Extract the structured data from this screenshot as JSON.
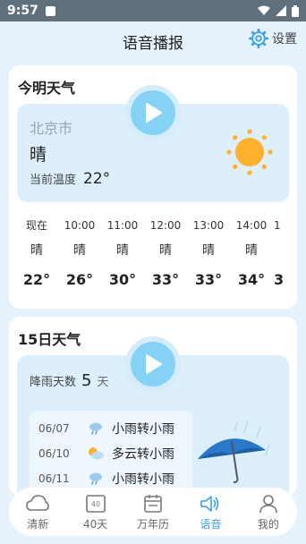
{
  "status_bar": {
    "time": "9:57"
  },
  "header": {
    "title": "语音播报",
    "settings_label": "设置"
  },
  "today": {
    "title": "今明天气",
    "city": "北京市",
    "condition": "晴",
    "current_temp_label": "当前温度",
    "current_temp": "22°",
    "hourly": [
      {
        "time": "现在",
        "cond": "晴",
        "temp": "22°"
      },
      {
        "time": "10:00",
        "cond": "晴",
        "temp": "26°"
      },
      {
        "time": "11:00",
        "cond": "晴",
        "temp": "30°"
      },
      {
        "time": "12:00",
        "cond": "晴",
        "temp": "33°"
      },
      {
        "time": "13:00",
        "cond": "晴",
        "temp": "33°"
      },
      {
        "time": "14:00",
        "cond": "晴",
        "temp": "34°"
      },
      {
        "time": "1",
        "cond": "",
        "temp": "3"
      }
    ]
  },
  "fifteen": {
    "title": "15日天气",
    "rain_days_label": "降雨天数",
    "rain_days_value": "5",
    "rain_days_unit": "天",
    "items": [
      {
        "date": "06/07",
        "icon": "rain-cloud-icon",
        "desc": "小雨转小雨"
      },
      {
        "date": "06/10",
        "icon": "partly-cloudy-icon",
        "desc": "多云转小雨"
      },
      {
        "date": "06/11",
        "icon": "rain-cloud-icon",
        "desc": "小雨转小雨"
      }
    ]
  },
  "tabs": [
    {
      "label": "清新",
      "icon": "cloud-icon",
      "active": false
    },
    {
      "label": "40天",
      "icon": "calendar-40-icon",
      "active": false
    },
    {
      "label": "万年历",
      "icon": "almanac-icon",
      "active": false
    },
    {
      "label": "语音",
      "icon": "speaker-icon",
      "active": true
    },
    {
      "label": "我的",
      "icon": "profile-icon",
      "active": false
    }
  ],
  "colors": {
    "accent": "#3aa0e8",
    "sun": "#ffb02e",
    "play": "#86d1f6"
  }
}
